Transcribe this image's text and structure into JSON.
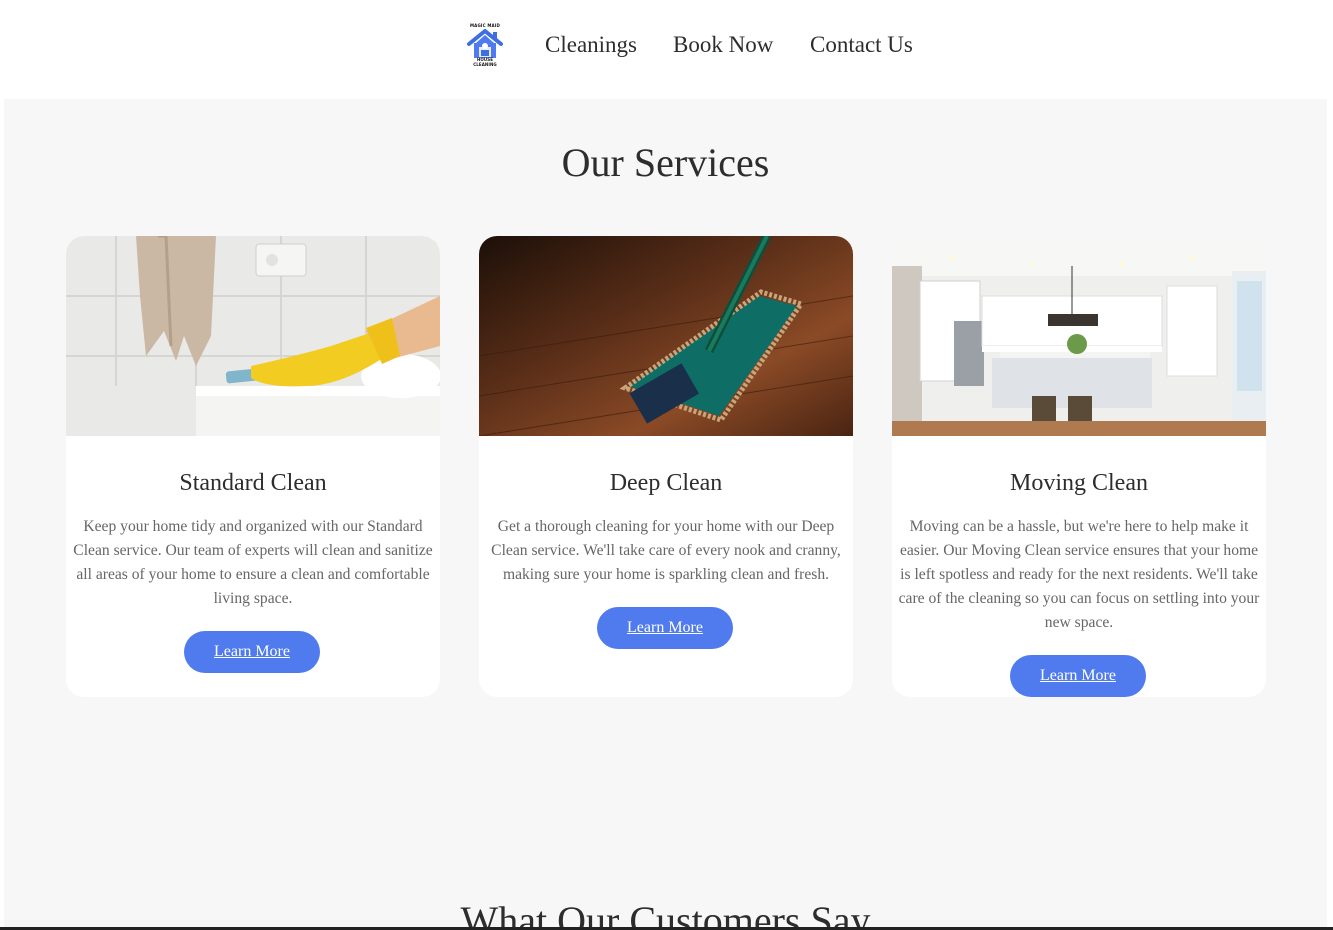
{
  "logo": {
    "top_text": "MAGIC MAID",
    "bottom_text": "HOUSE CLEANING",
    "icon": "house-icon"
  },
  "nav": {
    "items": [
      {
        "label": "Cleanings"
      },
      {
        "label": "Book Now"
      },
      {
        "label": "Contact Us"
      }
    ]
  },
  "services": {
    "title": "Our Services",
    "cards": [
      {
        "title": "Standard Clean",
        "image": "gloved-hand-wiping-counter",
        "description": "Keep your home tidy and organized with our Standard Clean service. Our team of experts will clean and sanitize all areas of your home to ensure a clean and comfortable living space.",
        "button": "Learn More"
      },
      {
        "title": "Deep Clean",
        "image": "mop-on-wood-floor",
        "description": "Get a thorough cleaning for your home with our Deep Clean service. We'll take care of every nook and cranny, making sure your home is sparkling clean and fresh.",
        "button": "Learn More"
      },
      {
        "title": "Moving Clean",
        "image": "bright-kitchen-interior",
        "description": "Moving can be a hassle, but we're here to help make it easier. Our Moving Clean service ensures that your home is left spotless and ready for the next residents. We'll take care of the cleaning so you can focus on settling into your new space.",
        "button": "Learn More"
      }
    ]
  },
  "testimonials": {
    "title": "What Our Customers Say"
  },
  "colors": {
    "accent": "#4f7bef",
    "section_bg": "#f7f7f7",
    "text": "#2d2d2d",
    "muted": "#666666"
  }
}
